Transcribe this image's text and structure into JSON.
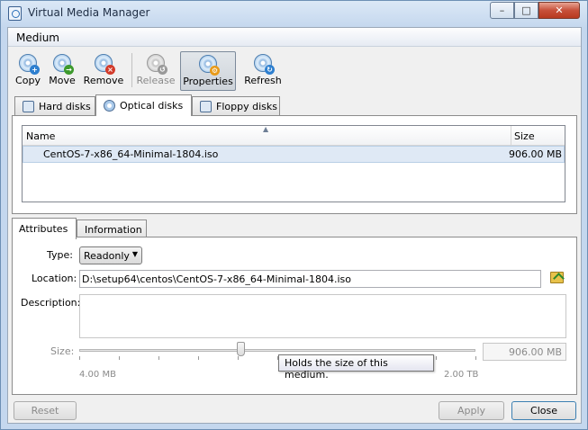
{
  "window": {
    "title": "Virtual Media Manager",
    "controls": [
      "–",
      "□",
      "✕"
    ]
  },
  "menubar": {
    "medium": "Medium"
  },
  "toolbar": {
    "copy": "Copy",
    "move": "Move",
    "remove": "Remove",
    "release": "Release",
    "properties": "Properties",
    "refresh": "Refresh"
  },
  "media_tabs": {
    "hard_disks": "Hard disks",
    "optical_disks": "Optical disks",
    "floppy_disks": "Floppy disks"
  },
  "media_list": {
    "columns": {
      "name": "Name",
      "size": "Size"
    },
    "sort_indicator": "▲",
    "rows": [
      {
        "name": "CentOS-7-x86_64-Minimal-1804.iso",
        "size": "906.00 MB"
      }
    ]
  },
  "detail_tabs": {
    "attributes": "Attributes",
    "information": "Information"
  },
  "attributes": {
    "type_label": "Type:",
    "type_value": "Readonly",
    "type_arrow": "▼",
    "location_label": "Location:",
    "location_value": "D:\\setup64\\centos\\CentOS-7-x86_64-Minimal-1804.iso",
    "description_label": "Description:",
    "size_label": "Size:",
    "size_value": "906.00 MB",
    "size_min": "4.00 MB",
    "size_max": "2.00 TB",
    "slider_fraction": 0.41
  },
  "tooltip": {
    "text": "Holds the size of this medium."
  },
  "buttons": {
    "reset": "Reset",
    "apply": "Apply",
    "close": "Close"
  }
}
